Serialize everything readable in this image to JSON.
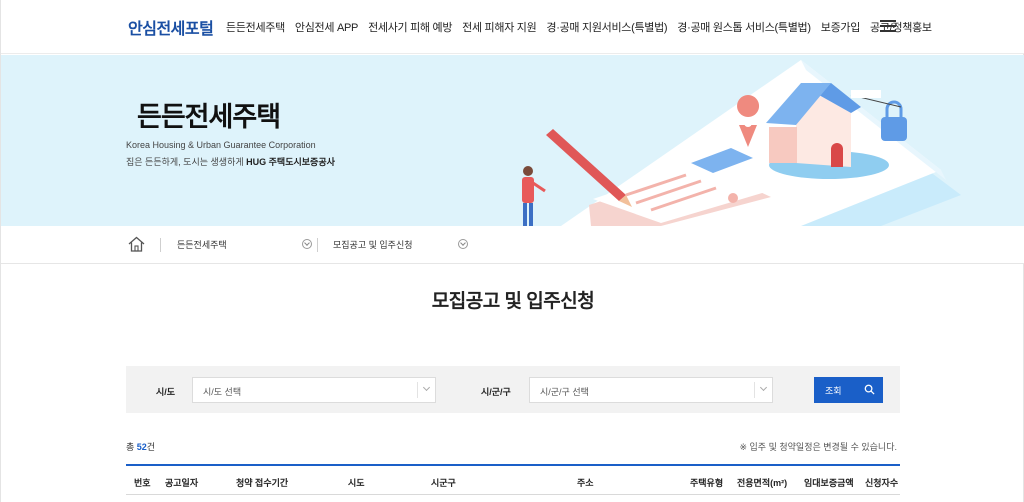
{
  "header": {
    "logo": "안심전세포털",
    "nav": [
      "든든전세주택",
      "안심전세 APP",
      "전세사기 피해 예방",
      "전세 피해자 지원",
      "경·공매 지원서비스(특별법)",
      "경·공매 원스톱 서비스(특별법)",
      "보증가입",
      "공고/정책홍보"
    ],
    "menu_icon": "hamburger-icon"
  },
  "hero": {
    "title": "든든전세주택",
    "org_en": "Korea Housing & Urban Guarantee Corporation",
    "slogan_prefix": "집은 든든하게, 도시는 생생하게 ",
    "slogan_org": "HUG 주택도시보증공사",
    "bg_color": "#def3fb"
  },
  "breadcrumb": {
    "home_icon": "home-icon",
    "items": [
      "든든전세주택",
      "모집공고 및 입주신청"
    ]
  },
  "page_title": "모집공고 및 입주신청",
  "search": {
    "sido_label": "시/도",
    "sido_value": "시/도 선택",
    "sigungu_label": "시/군/구",
    "sigungu_value": "시/군/구 선택",
    "button_label": "조회",
    "button_color": "#1a5fc8"
  },
  "summary": {
    "total_prefix": "총 ",
    "total_count": "52",
    "total_suffix": "건",
    "notice": "※ 입주 및 청약일정은 변경될 수 있습니다."
  },
  "table": {
    "headers": [
      "번호",
      "공고일자",
      "청약 접수기간",
      "시도",
      "시군구",
      "주소",
      "주택유형",
      "전용면적(m²)",
      "임대보증금액",
      "신청자수"
    ]
  }
}
